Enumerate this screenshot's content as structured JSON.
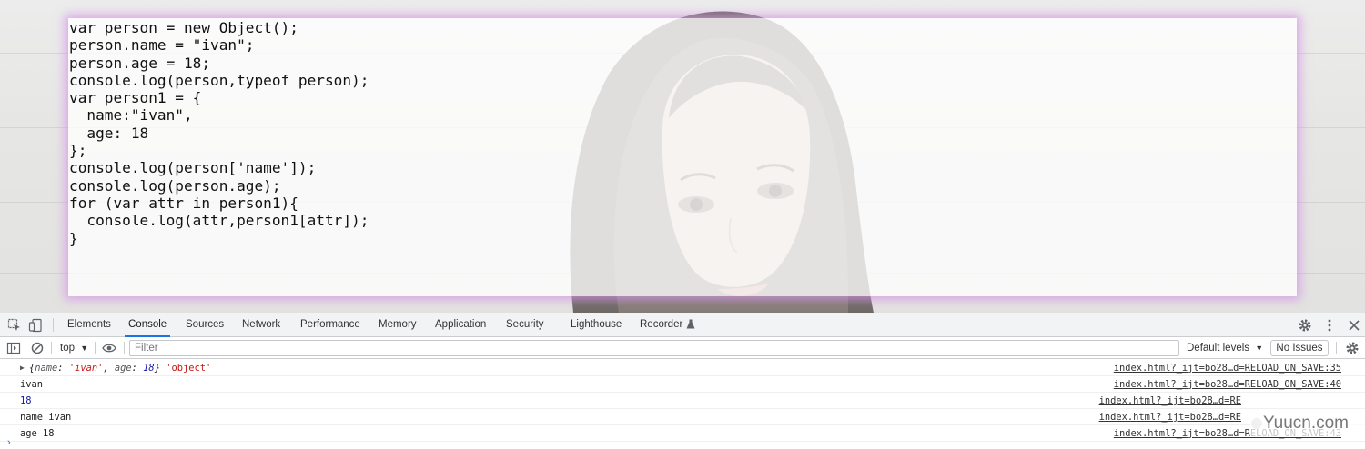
{
  "webpage": {
    "code_lines": [
      "var person = new Object();",
      "person.name = \"ivan\";",
      "person.age = 18;",
      "console.log(person,typeof person);",
      "var person1 = {",
      "  name:\"ivan\",",
      "  age: 18",
      "};",
      "console.log(person['name']);",
      "console.log(person.age);",
      "for (var attr in person1){",
      "  console.log(attr,person1[attr]);",
      "}"
    ]
  },
  "devtools": {
    "tabs": [
      {
        "label": "Elements"
      },
      {
        "label": "Console",
        "active": true
      },
      {
        "label": "Sources"
      },
      {
        "label": "Network"
      },
      {
        "label": "Performance"
      },
      {
        "label": "Memory"
      },
      {
        "label": "Application"
      },
      {
        "label": "Security"
      },
      {
        "label": "Lighthouse"
      },
      {
        "label": "Recorder"
      }
    ],
    "toolbar": {
      "context": "top",
      "filter_placeholder": "Filter",
      "levels": "Default levels",
      "issues": "No Issues"
    },
    "messages": [
      {
        "obj_prefix": "{",
        "k1": "name",
        "s1": "'ivan'",
        "k2": "age",
        "n2": "18",
        "obj_suffix": "}",
        "typestr": "'object'",
        "source": "index.html?_ijt=bo28…d=RELOAD_ON_SAVE:35"
      },
      {
        "text": "ivan",
        "source": "index.html?_ijt=bo28…d=RELOAD_ON_SAVE:40"
      },
      {
        "num": "18",
        "source": "index.html?_ijt=bo28…d=RE"
      },
      {
        "text": "name ivan",
        "source": "index.html?_ijt=bo28…d=RE"
      },
      {
        "text": "age 18",
        "source": "index.html?_ijt=bo28…d=RELOAD_ON_SAVE:43"
      }
    ],
    "prompt": "›"
  },
  "watermark": "Yuucn.com",
  "colors": {
    "accent": "#1a73e8",
    "string": "#c41a16",
    "number": "#1a1aa6",
    "glow": "#d696e6"
  }
}
